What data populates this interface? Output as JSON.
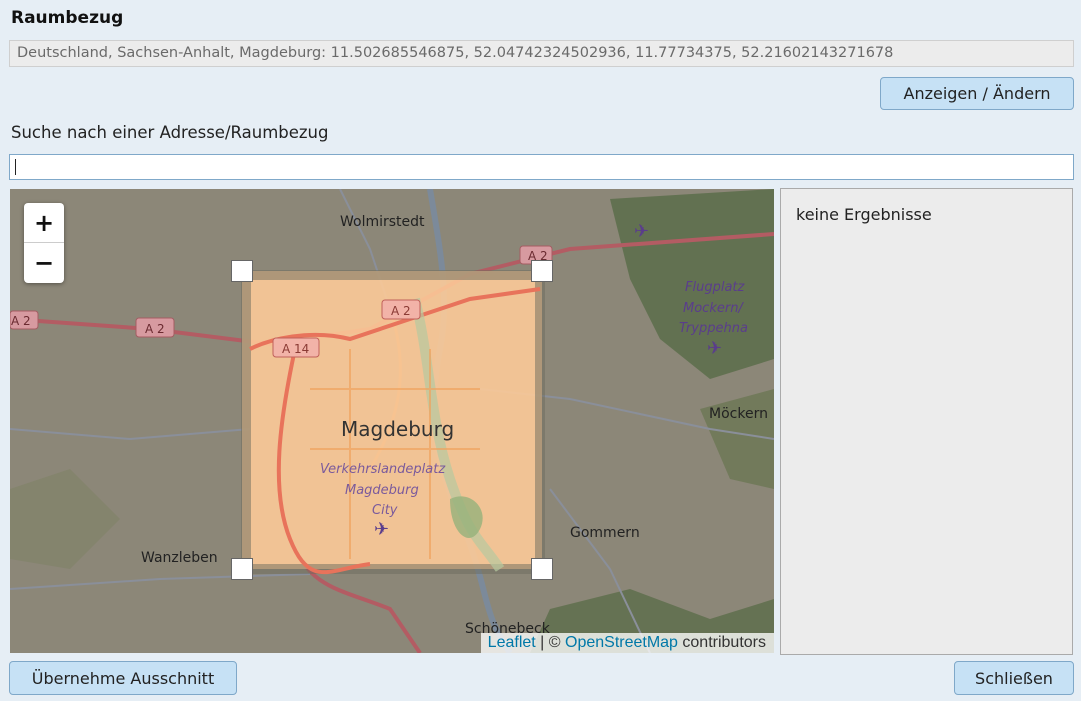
{
  "header": {
    "title": "Raumbezug"
  },
  "coordinates": {
    "value": "Deutschland, Sachsen-Anhalt, Magdeburg: 11.502685546875, 52.04742324502936, 11.77734375, 52.21602143271678"
  },
  "buttons": {
    "show_change": "Anzeigen / Ändern",
    "apply_extent": "Übernehme Ausschnitt",
    "close": "Schließen"
  },
  "search": {
    "label": "Suche nach einer Adresse/Raumbezug",
    "value": "",
    "placeholder": ""
  },
  "results": {
    "empty_text": "keine Ergebnisse"
  },
  "map": {
    "zoom_in": "+",
    "zoom_out": "−",
    "attribution": {
      "leaflet": "Leaflet",
      "separator": " | © ",
      "osm": "OpenStreetMap",
      "suffix": " contributors"
    },
    "labels": {
      "wolmirstedt": "Wolmirstedt",
      "a2_top": "A 2",
      "a2_left_edge": "A 2",
      "a2_left": "A 2",
      "a2_center": "A 2",
      "a14": "A 14",
      "magdeburg": "Magdeburg",
      "airport_line1": "Verkehrslandeplatz",
      "airport_line2": "Magdeburg",
      "airport_line3": "City",
      "flugplatz_line1": "Flugplatz",
      "flugplatz_line2": "Mockern/",
      "flugplatz_line3": "Tryppehna",
      "mockern": "Möckern",
      "gommern": "Gommern",
      "wanzleben": "Wanzleben",
      "schoenebeck": "Schönebeck"
    }
  }
}
